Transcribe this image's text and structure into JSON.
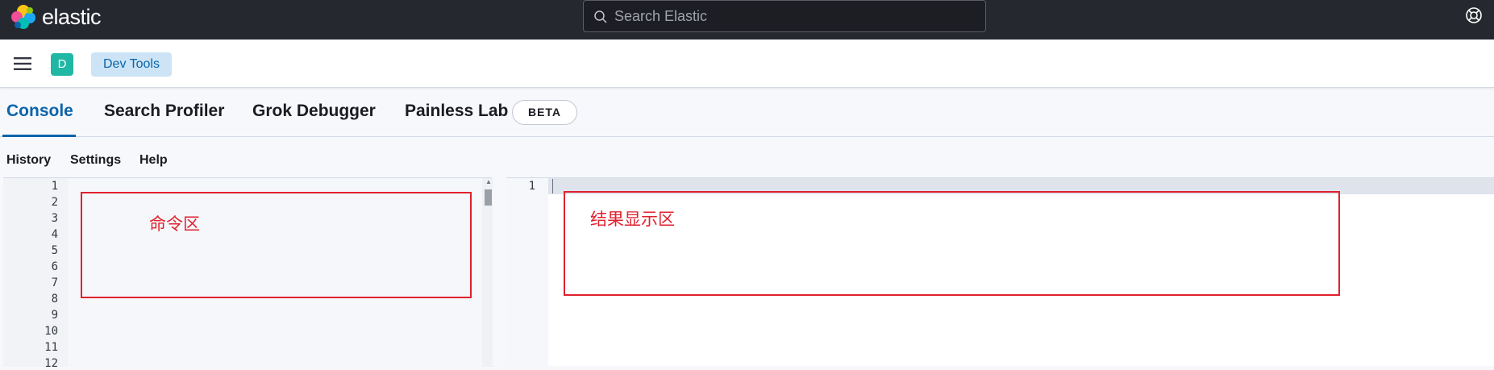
{
  "header": {
    "logo_text": "elastic",
    "search_placeholder": "Search Elastic",
    "colors": {
      "bg": "#25282f",
      "logo_pink": "#f04e98",
      "logo_yellow": "#fec514",
      "logo_teal": "#00bfb3",
      "logo_blue": "#1ba9f5"
    }
  },
  "breadcrumb": {
    "avatar_letter": "D",
    "items": [
      "Dev Tools"
    ]
  },
  "tabs": [
    {
      "label": "Console",
      "active": true
    },
    {
      "label": "Search Profiler",
      "active": false
    },
    {
      "label": "Grok Debugger",
      "active": false
    },
    {
      "label": "Painless Lab",
      "active": false,
      "badge": "BETA"
    }
  ],
  "console_menu": [
    "History",
    "Settings",
    "Help"
  ],
  "request_editor": {
    "line_numbers": [
      "1",
      "2",
      "3",
      "4",
      "5",
      "6",
      "7",
      "8",
      "9",
      "10",
      "11",
      "12"
    ]
  },
  "response_editor": {
    "line_numbers": [
      "1"
    ]
  },
  "annotations": {
    "command_area": "命令区",
    "result_area": "结果显示区",
    "color": "#e0212f"
  }
}
